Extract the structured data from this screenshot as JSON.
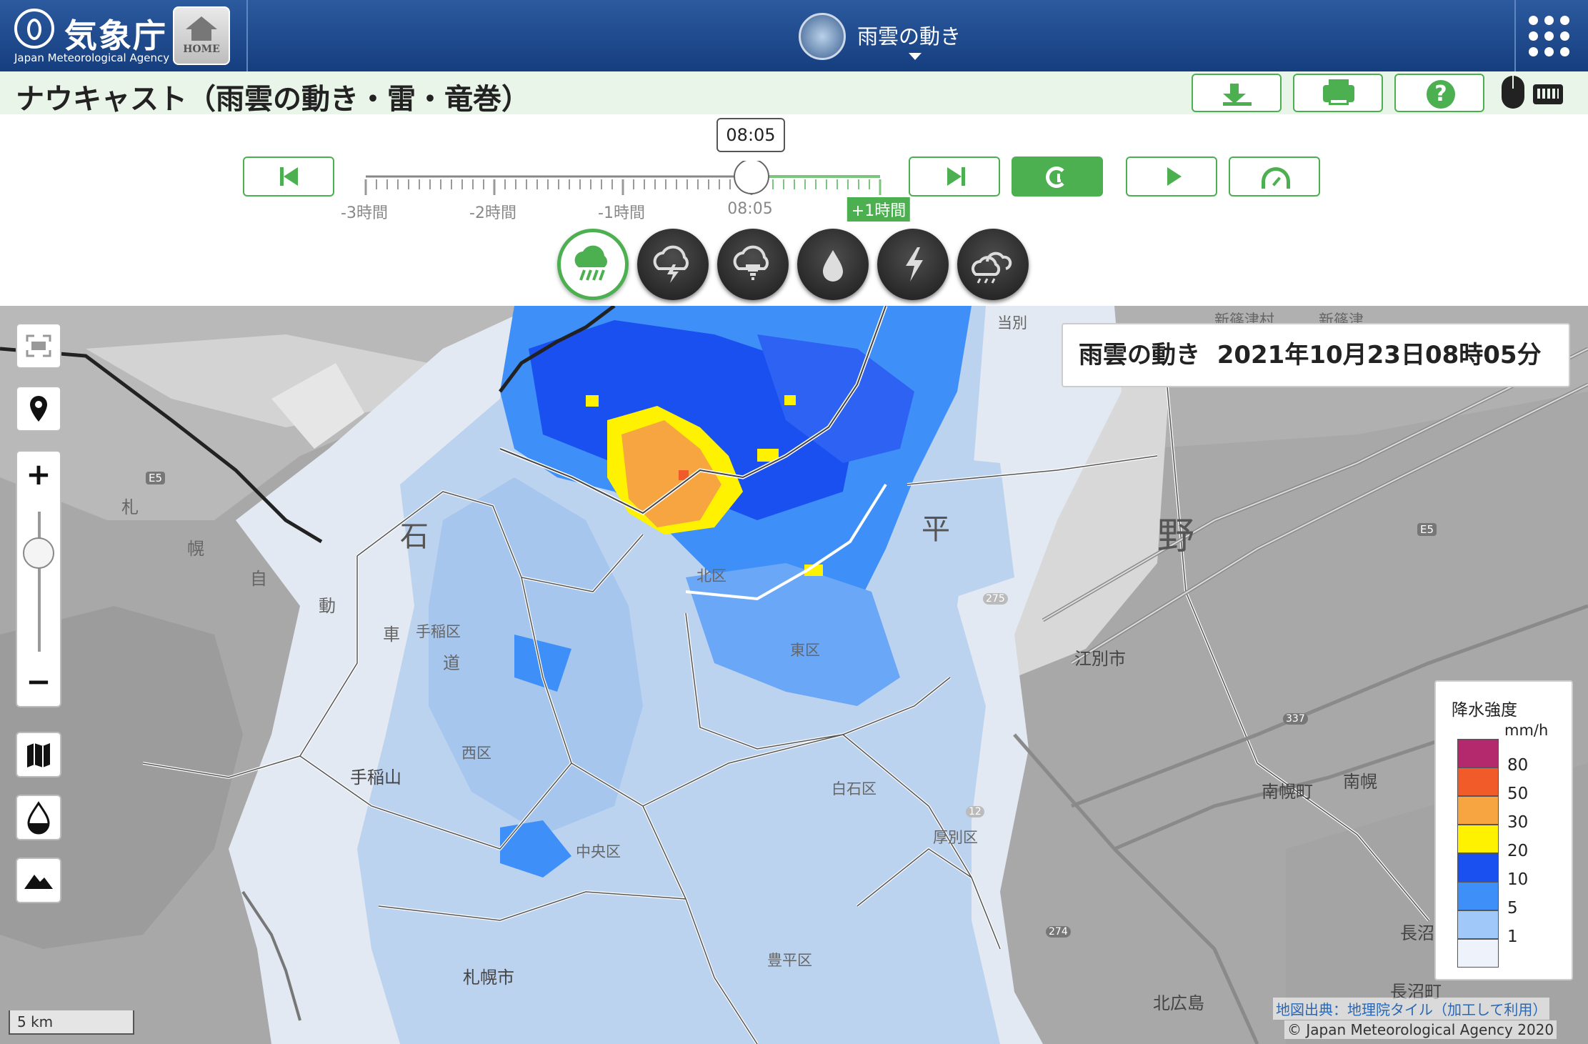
{
  "header": {
    "logo_text": "気象庁",
    "logo_sub": "Japan Meteorological Agency",
    "home_label": "HOME",
    "product_title": "雨雲の動き",
    "page_title": "ナウキャスト（雨雲の動き・雷・竜巻）"
  },
  "toolbar": {
    "icons": [
      "download-icon",
      "print-icon",
      "help-icon",
      "mouse-icon",
      "keyboard-icon"
    ],
    "help_glyph": "?"
  },
  "playback": {
    "current_time": "08:05",
    "tick_labels": [
      "-3時間",
      "-2時間",
      "-1時間",
      "08:05",
      "+1時間"
    ],
    "buttons": [
      "skip-to-start",
      "skip-to-end",
      "latest",
      "play",
      "speed"
    ],
    "position_fraction": 0.75
  },
  "elements": [
    {
      "name": "rain-cloud",
      "active": true
    },
    {
      "name": "thunder-cloud",
      "active": false
    },
    {
      "name": "tornado",
      "active": false
    },
    {
      "name": "precipitation",
      "active": false
    },
    {
      "name": "lightning",
      "active": false
    },
    {
      "name": "cloud-layers",
      "active": false
    }
  ],
  "map": {
    "info_title": "雨雲の動き",
    "info_datetime": "2021年10月23日08時05分",
    "place_labels": [
      "北区",
      "東区",
      "手稲区",
      "西区",
      "白石区",
      "中央区",
      "厚別区",
      "豊平区",
      "札幌市",
      "江別市",
      "南幌町",
      "南幌",
      "北広島",
      "長沼",
      "長沼町",
      "手稲山",
      "当別",
      "新篠津村",
      "新篠津"
    ],
    "big_labels": [
      "石",
      "平",
      "野",
      "札",
      "幌",
      "自",
      "動",
      "車",
      "道"
    ],
    "road_badges": [
      "E5",
      "E5",
      "275",
      "337",
      "274",
      "12"
    ],
    "scale_label": "5 km",
    "credit_source": "地図出典：地理院タイル（加工して利用）",
    "credit_copyright": "© Japan Meteorological Agency 2020"
  },
  "legend": {
    "title": "降水強度",
    "unit": "mm/h",
    "levels": [
      {
        "label": "80",
        "color": "#b4286e"
      },
      {
        "label": "50",
        "color": "#f15a29"
      },
      {
        "label": "30",
        "color": "#f7a541"
      },
      {
        "label": "20",
        "color": "#fff200"
      },
      {
        "label": "10",
        "color": "#1a4ff0"
      },
      {
        "label": "5",
        "color": "#3f8ff8"
      },
      {
        "label": "1",
        "color": "#a0c8f8"
      },
      {
        "label": "",
        "color": "#eef3fb"
      }
    ]
  },
  "colors": {
    "accent": "#4caf50",
    "header": "#1f4a8c"
  }
}
